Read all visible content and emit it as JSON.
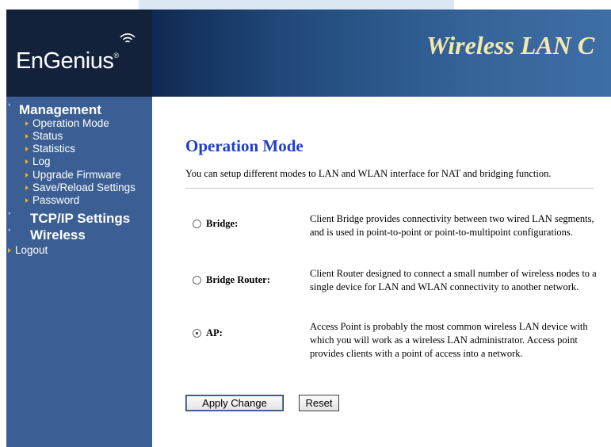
{
  "header": {
    "logo_text": "EnGenius",
    "logo_reg": "®",
    "banner_title": "Wireless LAN C"
  },
  "sidebar": {
    "management": "Management",
    "items": [
      "Operation Mode",
      "Status",
      "Statistics",
      "Log",
      "Upgrade Firmware",
      "Save/Reload Settings",
      "Password"
    ],
    "tcpip": "TCP/IP Settings",
    "wireless": "Wireless",
    "logout": "Logout"
  },
  "main": {
    "title": "Operation Mode",
    "description": "You can setup different modes to LAN and WLAN interface for NAT and bridging function.",
    "modes": [
      {
        "label": "Bridge:",
        "selected": false,
        "desc": "Client Bridge provides connectivity between two wired LAN segments, and is used in point-to-point or point-to-multipoint configurations."
      },
      {
        "label": "Bridge Router:",
        "selected": false,
        "desc": "Client Router designed to connect a small number of wireless nodes to a single device for LAN and WLAN connectivity to another network."
      },
      {
        "label": "AP:",
        "selected": true,
        "desc": "Access Point is probably the most common wireless LAN device with which you will work as a wireless LAN administrator. Access point provides clients with a point of access into a network."
      }
    ],
    "apply_label": "Apply Change",
    "reset_label": "Reset"
  },
  "colors": {
    "sidebar_bg": "#3b5f94",
    "heading": "#1e3ec8",
    "banner_title": "#f3e9b0",
    "logo_bg": "#13213b"
  }
}
